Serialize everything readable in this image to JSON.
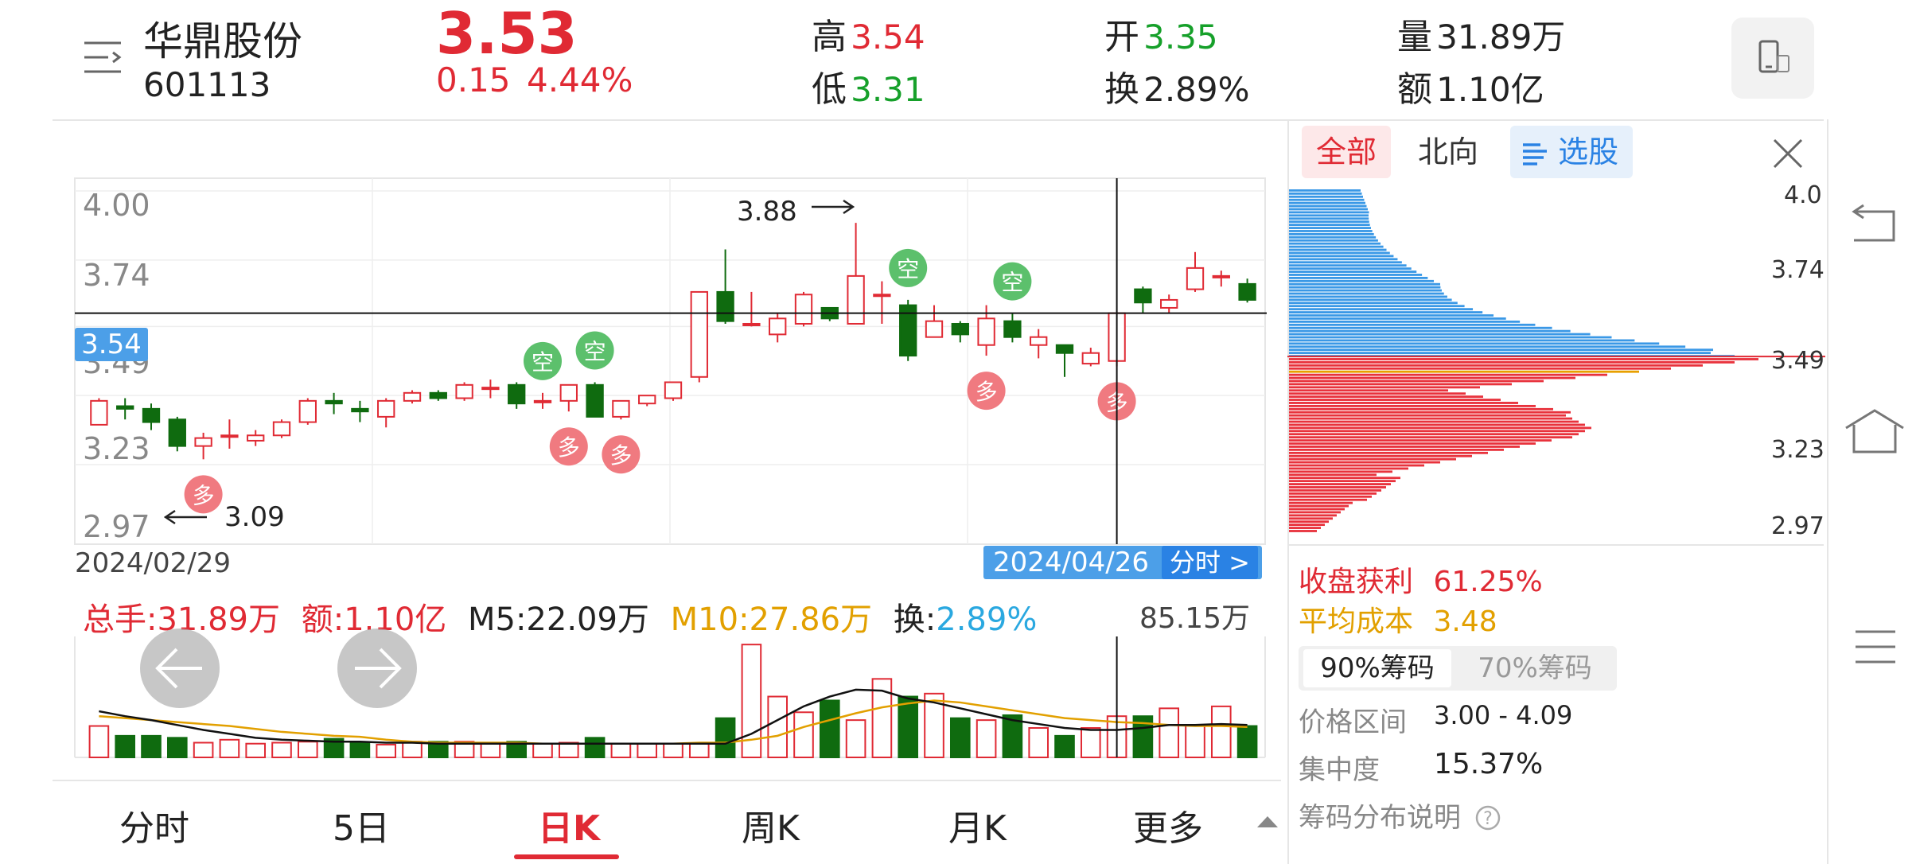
{
  "stock": {
    "name": "华鼎股份",
    "code": "601113",
    "price": "3.53",
    "change": "0.15",
    "change_pct": "4.44%"
  },
  "quote": {
    "high_label": "高",
    "high": "3.54",
    "low_label": "低",
    "low": "3.31",
    "open_label": "开",
    "open": "3.35",
    "turnover_label": "换",
    "turnover": "2.89%",
    "volume_label": "量",
    "volume": "31.89万",
    "amount_label": "额",
    "amount": "1.10亿"
  },
  "colors": {
    "up": "#e02a34",
    "down": "#0f6b0f",
    "m5": "#111111",
    "m10": "#e2a000",
    "accent": "#2a82e4",
    "chip_profit": "#e8323c",
    "chip_loss": "#3a98e6"
  },
  "chart": {
    "y_ticks": [
      "4.00",
      "3.74",
      "3.49",
      "3.23",
      "2.97"
    ],
    "start_date": "2024/02/29",
    "cursor_date": "2024/04/26",
    "cursor_price": "3.54",
    "time_share_btn": "分时 >",
    "high_annot": "3.88",
    "low_annot": "3.09",
    "signal_buy": "多",
    "signal_sell": "空"
  },
  "volume_bar": {
    "total_label": "总手:",
    "total": "31.89万",
    "amount_label": "额:",
    "amount": "1.10亿",
    "m5_label": "M5:",
    "m5": "22.09万",
    "m10_label": "M10:",
    "m10": "27.86万",
    "turn_label": "换:",
    "turn": "2.89%",
    "max": "85.15万"
  },
  "chart_data": {
    "type": "candlestick",
    "price_axis": {
      "min": 2.97,
      "max": 4.0,
      "ticks": [
        4.0,
        3.74,
        3.49,
        3.23,
        2.97
      ]
    },
    "candles": [
      {
        "o": 3.12,
        "c": 3.21,
        "h": 3.22,
        "l": 3.12
      },
      {
        "o": 3.19,
        "c": 3.18,
        "h": 3.22,
        "l": 3.14
      },
      {
        "o": 3.18,
        "c": 3.13,
        "h": 3.2,
        "l": 3.1
      },
      {
        "o": 3.14,
        "c": 3.04,
        "h": 3.15,
        "l": 3.02
      },
      {
        "o": 3.04,
        "c": 3.07,
        "h": 3.09,
        "l": 2.99
      },
      {
        "o": 3.08,
        "c": 3.08,
        "h": 3.14,
        "l": 3.03
      },
      {
        "o": 3.06,
        "c": 3.08,
        "h": 3.1,
        "l": 3.04
      },
      {
        "o": 3.08,
        "c": 3.13,
        "h": 3.14,
        "l": 3.07
      },
      {
        "o": 3.13,
        "c": 3.21,
        "h": 3.22,
        "l": 3.12
      },
      {
        "o": 3.21,
        "c": 3.2,
        "h": 3.24,
        "l": 3.16
      },
      {
        "o": 3.18,
        "c": 3.17,
        "h": 3.21,
        "l": 3.13
      },
      {
        "o": 3.15,
        "c": 3.21,
        "h": 3.22,
        "l": 3.11
      },
      {
        "o": 3.21,
        "c": 3.24,
        "h": 3.25,
        "l": 3.2
      },
      {
        "o": 3.24,
        "c": 3.22,
        "h": 3.25,
        "l": 3.21
      },
      {
        "o": 3.22,
        "c": 3.27,
        "h": 3.28,
        "l": 3.21
      },
      {
        "o": 3.26,
        "c": 3.26,
        "h": 3.29,
        "l": 3.22
      },
      {
        "o": 3.27,
        "c": 3.2,
        "h": 3.28,
        "l": 3.18
      },
      {
        "o": 3.21,
        "c": 3.21,
        "h": 3.24,
        "l": 3.18
      },
      {
        "o": 3.21,
        "c": 3.27,
        "h": 3.27,
        "l": 3.17
      },
      {
        "o": 3.27,
        "c": 3.15,
        "h": 3.28,
        "l": 3.15
      },
      {
        "o": 3.15,
        "c": 3.21,
        "h": 3.21,
        "l": 3.14
      },
      {
        "o": 3.2,
        "c": 3.23,
        "h": 3.23,
        "l": 3.19
      },
      {
        "o": 3.22,
        "c": 3.28,
        "h": 3.28,
        "l": 3.21
      },
      {
        "o": 3.3,
        "c": 3.62,
        "h": 3.62,
        "l": 3.28
      },
      {
        "o": 3.62,
        "c": 3.51,
        "h": 3.78,
        "l": 3.5
      },
      {
        "o": 3.5,
        "c": 3.5,
        "h": 3.62,
        "l": 3.49
      },
      {
        "o": 3.46,
        "c": 3.52,
        "h": 3.54,
        "l": 3.43
      },
      {
        "o": 3.5,
        "c": 3.61,
        "h": 3.62,
        "l": 3.49
      },
      {
        "o": 3.56,
        "c": 3.52,
        "h": 3.56,
        "l": 3.51
      },
      {
        "o": 3.5,
        "c": 3.68,
        "h": 3.88,
        "l": 3.5
      },
      {
        "o": 3.61,
        "c": 3.61,
        "h": 3.66,
        "l": 3.5
      },
      {
        "o": 3.57,
        "c": 3.38,
        "h": 3.59,
        "l": 3.36
      },
      {
        "o": 3.45,
        "c": 3.51,
        "h": 3.57,
        "l": 3.45
      },
      {
        "o": 3.5,
        "c": 3.46,
        "h": 3.51,
        "l": 3.43
      },
      {
        "o": 3.42,
        "c": 3.52,
        "h": 3.57,
        "l": 3.38
      },
      {
        "o": 3.51,
        "c": 3.45,
        "h": 3.54,
        "l": 3.43
      },
      {
        "o": 3.42,
        "c": 3.45,
        "h": 3.48,
        "l": 3.37
      },
      {
        "o": 3.42,
        "c": 3.39,
        "h": 3.42,
        "l": 3.3
      },
      {
        "o": 3.35,
        "c": 3.39,
        "h": 3.41,
        "l": 3.34
      },
      {
        "o": 3.36,
        "c": 3.54,
        "h": 3.54,
        "l": 3.34
      },
      {
        "o": 3.63,
        "c": 3.58,
        "h": 3.64,
        "l": 3.54
      },
      {
        "o": 3.56,
        "c": 3.59,
        "h": 3.61,
        "l": 3.54
      },
      {
        "o": 3.63,
        "c": 3.71,
        "h": 3.77,
        "l": 3.62
      },
      {
        "o": 3.68,
        "c": 3.68,
        "h": 3.7,
        "l": 3.64
      },
      {
        "o": 3.65,
        "c": 3.59,
        "h": 3.67,
        "l": 3.58
      }
    ],
    "volumes": [
      32,
      22,
      22,
      20,
      15,
      18,
      14,
      15,
      16,
      19,
      15,
      13,
      16,
      16,
      16,
      15,
      16,
      14,
      15,
      20,
      14,
      14,
      14,
      14,
      40,
      115,
      62,
      46,
      58,
      38,
      80,
      62,
      65,
      40,
      38,
      43,
      30,
      22,
      30,
      42,
      42,
      50,
      33,
      52,
      32
    ],
    "m5": [
      47,
      42,
      38,
      33,
      28,
      24,
      20,
      18,
      17,
      16,
      16,
      15,
      15,
      14,
      14,
      14,
      14,
      14,
      14,
      14,
      14,
      14,
      14,
      14,
      14,
      24,
      38,
      52,
      62,
      69,
      68,
      60,
      56,
      50,
      44,
      38,
      34,
      30,
      28,
      28,
      30,
      33,
      33,
      34,
      33
    ],
    "m10": [
      42,
      40,
      38,
      36,
      34,
      32,
      29,
      26,
      24,
      22,
      21,
      18,
      16,
      15,
      15,
      15,
      15,
      14,
      14,
      14,
      14,
      14,
      14,
      15,
      15,
      18,
      22,
      31,
      38,
      45,
      51,
      55,
      58,
      56,
      52,
      48,
      44,
      40,
      38,
      36,
      35,
      33,
      32,
      32,
      31
    ],
    "buy_signals": [
      4,
      18,
      20,
      34,
      39
    ],
    "sell_signals": [
      17,
      19,
      31,
      35
    ]
  },
  "chips": {
    "tabs": [
      "全部",
      "北向",
      "选股"
    ],
    "price_ticks": [
      "4.0",
      "3.74",
      "3.49",
      "3.23",
      "2.97"
    ],
    "profit_label": "收盘获利",
    "profit": "61.25%",
    "avg_label": "平均成本",
    "avg": "3.48",
    "btn90": "90%筹码",
    "btn70": "70%筹码",
    "range_label": "价格区间",
    "range": "3.00 - 4.09",
    "conc_label": "集中度",
    "conc": "15.37%",
    "help": "筹码分布说明"
  },
  "tabs": [
    "分时",
    "5日",
    "日K",
    "周K",
    "月K",
    "更多"
  ]
}
